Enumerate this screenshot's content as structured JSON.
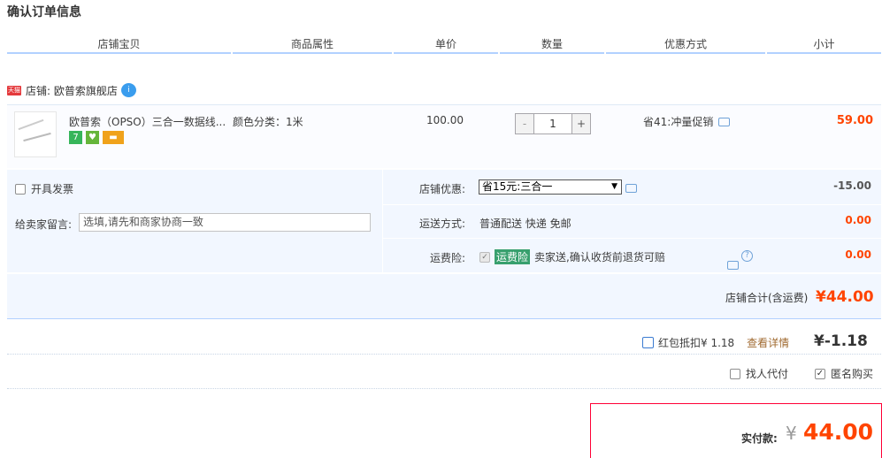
{
  "title": "确认订单信息",
  "headers": [
    "店铺宝贝",
    "商品属性",
    "单价",
    "数量",
    "优惠方式",
    "小计"
  ],
  "shop": {
    "badge": "天猫",
    "label": "店铺: 欧普索旗舰店",
    "ww_text": "i"
  },
  "item": {
    "name": "欧普索（OPSO）三合一数据线...",
    "sku": "颜色分类：1米",
    "price": "100.00",
    "qty_minus": "-",
    "qty": "1",
    "qty_plus": "+",
    "discount": "省41:冲量促销",
    "subtotal": "59.00",
    "badges": [
      "7",
      "♥",
      "▬"
    ]
  },
  "options": {
    "invoice_label": "开具发票",
    "note_label": "给卖家留言:",
    "note_placeholder": "选填,请先和商家协商一致",
    "shop_discount_label": "店铺优惠:",
    "shop_discount_value": "省15元:三合一",
    "shop_discount_amount": "-15.00",
    "delivery_label": "运送方式:",
    "delivery_value": "普通配送 快递 免邮",
    "delivery_amount": "0.00",
    "insurance_label": "运费险:",
    "insurance_badge": "运费险",
    "insurance_text": "卖家送,确认收货前退货可赔",
    "insurance_amount": "0.00",
    "help_glyph": "?"
  },
  "shop_total": {
    "label": "店铺合计(含运费)",
    "value": "¥44.00"
  },
  "redpacket": {
    "label": "红包抵扣¥ 1.18",
    "link": "查看详情",
    "value": "¥-1.18"
  },
  "extras": {
    "proxy_label": "找人代付",
    "anon_label": "匿名购买"
  },
  "pay": {
    "label": "实付款:",
    "yen": "¥",
    "value": "44.00"
  },
  "colors": {
    "accent": "#ff4400",
    "border_blue": "#b2d1ff",
    "pay_border": "#ff0036"
  }
}
